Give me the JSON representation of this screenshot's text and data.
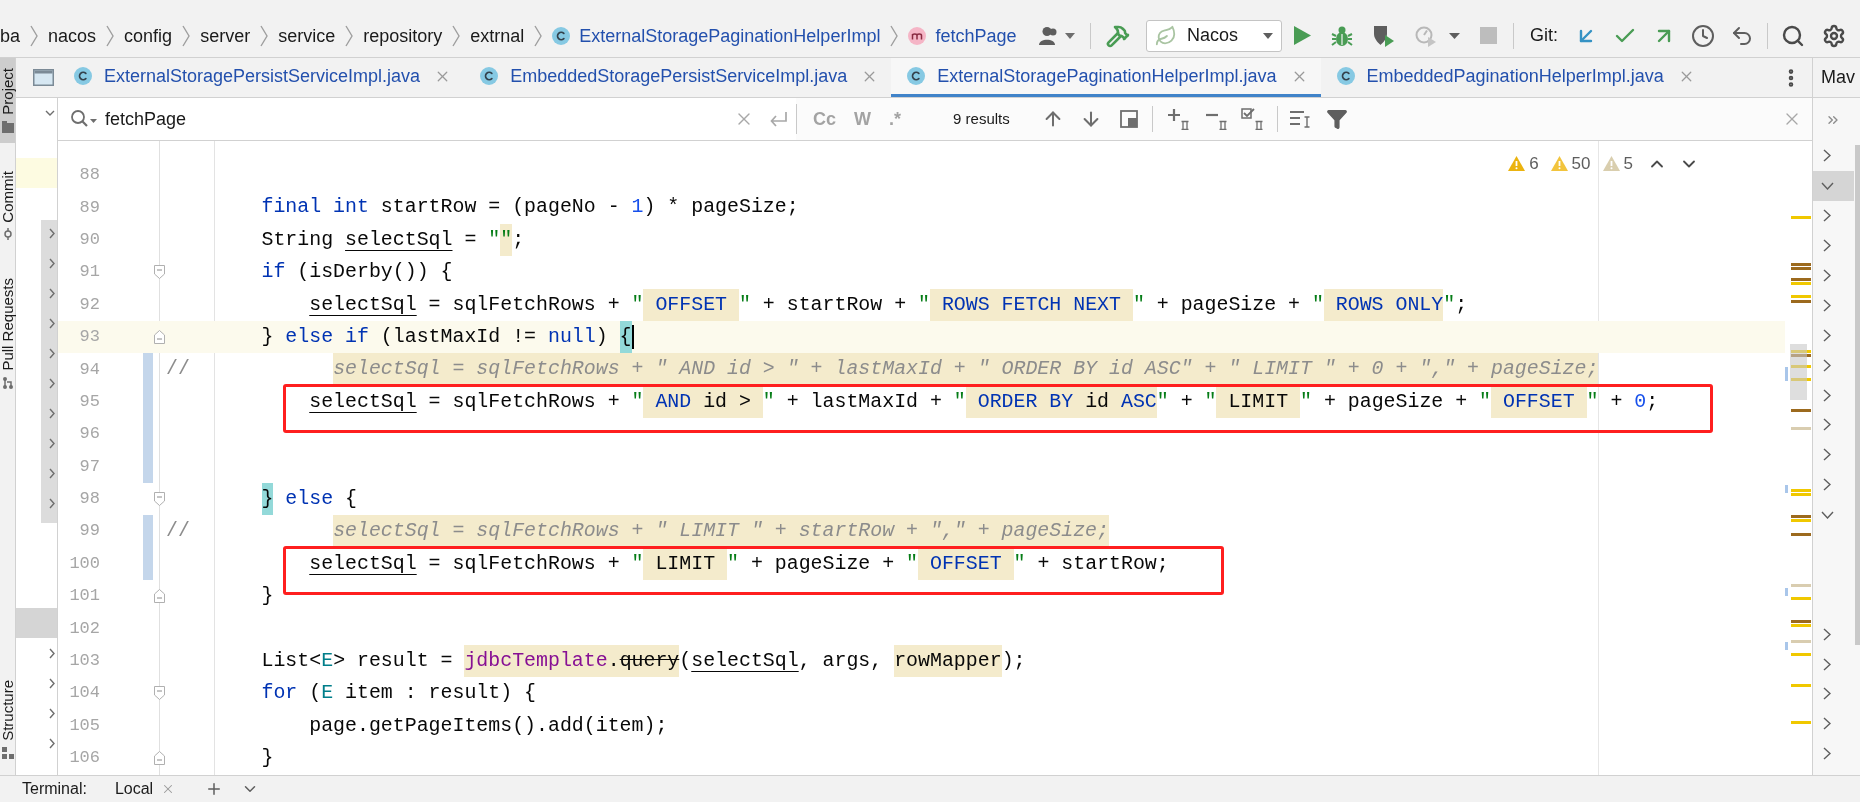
{
  "breadcrumbs": [
    {
      "label": "ba",
      "kind": "package"
    },
    {
      "label": "nacos",
      "kind": "package"
    },
    {
      "label": "config",
      "kind": "package"
    },
    {
      "label": "server",
      "kind": "package"
    },
    {
      "label": "service",
      "kind": "package"
    },
    {
      "label": "repository",
      "kind": "package"
    },
    {
      "label": "extrnal",
      "kind": "package"
    },
    {
      "label": "ExternalStoragePaginationHelperImpl",
      "kind": "class"
    },
    {
      "label": "fetchPage",
      "kind": "method"
    }
  ],
  "toolbar": {
    "run_config": {
      "label": "Nacos"
    },
    "run_actions": [
      {
        "kind": "run",
        "disabled": false
      },
      {
        "kind": "debug",
        "disabled": false
      },
      {
        "kind": "coverage",
        "disabled": false
      },
      {
        "kind": "profile",
        "disabled": true
      },
      {
        "kind": "more",
        "disabled": false
      },
      {
        "kind": "stop",
        "disabled": true
      }
    ],
    "vcs_label": "Git:",
    "vcs_actions": [
      {
        "kind": "update"
      },
      {
        "kind": "commit"
      },
      {
        "kind": "push"
      },
      {
        "kind": "history"
      },
      {
        "kind": "rollback"
      }
    ]
  },
  "tool_windows": {
    "top": [
      {
        "label": "Project",
        "kind": "project",
        "selected": true
      },
      {
        "label": "Commit",
        "kind": "commit",
        "selected": false
      },
      {
        "label": "Pull Requests",
        "kind": "pull-requests",
        "selected": false
      }
    ],
    "bottom": [
      {
        "label": "Structure",
        "kind": "structure",
        "selected": false
      }
    ]
  },
  "tabs": [
    {
      "label": "ExternalStoragePersistServiceImpl.java",
      "selected": false
    },
    {
      "label": "EmbeddedStoragePersistServiceImpl.java",
      "selected": false
    },
    {
      "label": "ExternalStoragePaginationHelperImpl.java",
      "selected": true
    },
    {
      "label": "EmbeddedPaginationHelperImpl.java",
      "selected": false
    }
  ],
  "project_panel": {
    "rows": [
      {
        "kind": "node",
        "expanded": true,
        "selected": false,
        "highlighted": false
      },
      {
        "kind": "leaf",
        "selected": false,
        "highlighted": false
      },
      {
        "kind": "leaf",
        "selected": false,
        "highlighted": true
      },
      {
        "kind": "leaf",
        "selected": false,
        "highlighted": false
      },
      {
        "kind": "node",
        "expanded": false,
        "selected": false,
        "highlighted": false
      },
      {
        "kind": "node",
        "expanded": false,
        "selected": false,
        "highlighted": false
      },
      {
        "kind": "node",
        "expanded": false,
        "selected": false,
        "highlighted": false
      },
      {
        "kind": "node",
        "expanded": false,
        "selected": false,
        "highlighted": false
      },
      {
        "kind": "node",
        "expanded": false,
        "selected": false,
        "highlighted": false
      },
      {
        "kind": "node",
        "expanded": false,
        "selected": false,
        "highlighted": false
      },
      {
        "kind": "node",
        "expanded": false,
        "selected": false,
        "highlighted": false
      },
      {
        "kind": "node",
        "expanded": false,
        "selected": false,
        "highlighted": false
      },
      {
        "kind": "node",
        "expanded": false,
        "selected": false,
        "highlighted": false
      },
      {
        "kind": "node",
        "expanded": false,
        "selected": false,
        "highlighted": false
      },
      {
        "kind": "leaf",
        "selected": false,
        "highlighted": false
      },
      {
        "kind": "leaf",
        "selected": false,
        "highlighted": false
      },
      {
        "kind": "leaf",
        "selected": false,
        "highlighted": false
      },
      {
        "kind": "leaf",
        "selected": true,
        "highlighted": false
      },
      {
        "kind": "node",
        "expanded": false,
        "selected": false,
        "highlighted": false
      },
      {
        "kind": "node",
        "expanded": false,
        "selected": false,
        "highlighted": false
      },
      {
        "kind": "node",
        "expanded": false,
        "selected": false,
        "highlighted": false
      },
      {
        "kind": "node",
        "expanded": false,
        "selected": false,
        "highlighted": false
      }
    ]
  },
  "find": {
    "value": "fetchPage",
    "options": [
      {
        "label": "Cc",
        "selected": false
      },
      {
        "label": "W",
        "selected": false
      },
      {
        "label": ".*",
        "selected": false
      }
    ],
    "results": "9 results"
  },
  "inspections": [
    {
      "count": "6",
      "color": "#ebb30f"
    },
    {
      "count": "50",
      "color": "#f2c43d"
    },
    {
      "count": "5",
      "color": "#d9ceae"
    }
  ],
  "editor": {
    "lines": [
      {
        "number": "88",
        "current": false,
        "changed": false,
        "boxed": false
      },
      {
        "number": "89",
        "current": false,
        "changed": false,
        "boxed": false,
        "tokens": [
          {
            "text": "        final int",
            "kind": "keyword"
          },
          {
            "text": " startRow = (pageNo - ",
            "kind": "plain"
          },
          {
            "text": "1",
            "kind": "number"
          },
          {
            "text": ") * pageSize;",
            "kind": "plain"
          }
        ]
      },
      {
        "number": "90",
        "current": false,
        "changed": false,
        "boxed": false,
        "tokens": [
          {
            "text": "        String ",
            "kind": "plain"
          },
          {
            "text": "selectSql",
            "kind": "variable"
          },
          {
            "text": " = ",
            "kind": "plain"
          },
          {
            "text": "\"",
            "kind": "quote"
          },
          {
            "text": "\"",
            "kind": "quote-marked"
          },
          {
            "text": ";",
            "kind": "plain"
          }
        ]
      },
      {
        "number": "91",
        "current": false,
        "changed": false,
        "boxed": false,
        "fold": {
          "kind": "start"
        },
        "tokens": [
          {
            "text": "        if",
            "kind": "keyword"
          },
          {
            "text": " (isDerby()) {",
            "kind": "plain"
          }
        ]
      },
      {
        "number": "92",
        "current": false,
        "changed": false,
        "boxed": false,
        "tokens": [
          {
            "text": "            selectSql",
            "kind": "variable"
          },
          {
            "text": " = sqlFetchRows + ",
            "kind": "plain"
          },
          {
            "text": "\"",
            "kind": "quote"
          },
          {
            "text": " OFFSET ",
            "kind": "sql-keyword"
          },
          {
            "text": "\"",
            "kind": "quote"
          },
          {
            "text": " + startRow + ",
            "kind": "plain"
          },
          {
            "text": "\"",
            "kind": "quote"
          },
          {
            "text": " ROWS FETCH NEXT ",
            "kind": "sql-keyword"
          },
          {
            "text": "\"",
            "kind": "quote"
          },
          {
            "text": " + pageSize + ",
            "kind": "plain"
          },
          {
            "text": "\"",
            "kind": "quote"
          },
          {
            "text": " ROWS ONLY",
            "kind": "sql-keyword"
          },
          {
            "text": "\"",
            "kind": "quote"
          },
          {
            "text": ";",
            "kind": "plain"
          }
        ]
      },
      {
        "number": "93",
        "current": true,
        "changed": false,
        "boxed": false,
        "fold": {
          "kind": "end"
        },
        "tokens": [
          {
            "text": "        }",
            "kind": "plain"
          },
          {
            "text": " else if",
            "kind": "keyword"
          },
          {
            "text": " (lastMaxId != ",
            "kind": "plain"
          },
          {
            "text": "null",
            "kind": "keyword"
          },
          {
            "text": ") ",
            "kind": "plain"
          },
          {
            "text": "{",
            "kind": "brace-match"
          }
        ]
      },
      {
        "number": "94",
        "current": false,
        "changed": true,
        "boxed": false,
        "tokens": [
          {
            "text": "//",
            "kind": "comment"
          },
          {
            "text": "            selectSql = sqlFetchRows + \" AND id > \" + lastMaxId + \" ORDER BY id ASC\" + \" LIMIT \" + 0 + \",\" + pageSize;",
            "kind": "comment-marked"
          }
        ]
      },
      {
        "number": "95",
        "current": false,
        "changed": true,
        "boxed": true,
        "tokens": [
          {
            "text": "            selectSql",
            "kind": "variable"
          },
          {
            "text": " = sqlFetchRows + ",
            "kind": "plain"
          },
          {
            "text": "\"",
            "kind": "quote"
          },
          {
            "text": " AND ",
            "kind": "sql-keyword"
          },
          {
            "text": "id > ",
            "kind": "sql"
          },
          {
            "text": "\"",
            "kind": "quote"
          },
          {
            "text": " + lastMaxId + ",
            "kind": "plain"
          },
          {
            "text": "\"",
            "kind": "quote"
          },
          {
            "text": " ORDER BY ",
            "kind": "sql-keyword"
          },
          {
            "text": "id",
            "kind": "sql"
          },
          {
            "text": " ASC",
            "kind": "sql-keyword"
          },
          {
            "text": "\"",
            "kind": "quote"
          },
          {
            "text": " + ",
            "kind": "plain"
          },
          {
            "text": "\"",
            "kind": "quote"
          },
          {
            "text": " LIMIT ",
            "kind": "sql"
          },
          {
            "text": "\"",
            "kind": "quote"
          },
          {
            "text": " + pageSize + ",
            "kind": "plain"
          },
          {
            "text": "\"",
            "kind": "quote"
          },
          {
            "text": " OFFSET ",
            "kind": "sql-keyword"
          },
          {
            "text": "\"",
            "kind": "quote"
          },
          {
            "text": " + ",
            "kind": "plain"
          },
          {
            "text": "0",
            "kind": "number"
          },
          {
            "text": ";",
            "kind": "plain"
          }
        ]
      },
      {
        "number": "96",
        "current": false,
        "changed": true,
        "boxed": false
      },
      {
        "number": "97",
        "current": false,
        "changed": true,
        "boxed": false
      },
      {
        "number": "98",
        "current": false,
        "changed": false,
        "boxed": false,
        "fold": {
          "kind": "start"
        },
        "tokens": [
          {
            "text": "        }",
            "kind": "brace-match"
          },
          {
            "text": " else",
            "kind": "keyword"
          },
          {
            "text": " {",
            "kind": "plain"
          }
        ]
      },
      {
        "number": "99",
        "current": false,
        "changed": true,
        "boxed": false,
        "tokens": [
          {
            "text": "//",
            "kind": "comment"
          },
          {
            "text": "            selectSql = sqlFetchRows + \" LIMIT \" + startRow + \",\" + pageSize;",
            "kind": "comment-marked"
          }
        ]
      },
      {
        "number": "100",
        "current": false,
        "changed": true,
        "boxed": true,
        "tokens": [
          {
            "text": "            selectSql",
            "kind": "variable"
          },
          {
            "text": " = sqlFetchRows + ",
            "kind": "plain"
          },
          {
            "text": "\"",
            "kind": "quote"
          },
          {
            "text": " LIMIT ",
            "kind": "sql"
          },
          {
            "text": "\"",
            "kind": "quote"
          },
          {
            "text": " + pageSize + ",
            "kind": "plain"
          },
          {
            "text": "\"",
            "kind": "quote"
          },
          {
            "text": " OFFSET ",
            "kind": "sql-keyword"
          },
          {
            "text": "\"",
            "kind": "quote"
          },
          {
            "text": " + startRow;",
            "kind": "plain"
          }
        ]
      },
      {
        "number": "101",
        "current": false,
        "changed": false,
        "boxed": false,
        "fold": {
          "kind": "end"
        },
        "tokens": [
          {
            "text": "        }",
            "kind": "plain"
          }
        ]
      },
      {
        "number": "102",
        "current": false,
        "changed": false,
        "boxed": false
      },
      {
        "number": "103",
        "current": false,
        "changed": false,
        "boxed": false,
        "tokens": [
          {
            "text": "        List<",
            "kind": "plain"
          },
          {
            "text": "E",
            "kind": "type-param"
          },
          {
            "text": "> result = ",
            "kind": "plain"
          },
          {
            "text": "jdbcTemplate",
            "kind": "field-marked"
          },
          {
            "text": ".",
            "kind": "marked"
          },
          {
            "text": "query",
            "kind": "deprecated-marked"
          },
          {
            "text": "(",
            "kind": "plain"
          },
          {
            "text": "selectSql",
            "kind": "variable"
          },
          {
            "text": ", args, ",
            "kind": "plain"
          },
          {
            "text": "rowMapper",
            "kind": "marked"
          },
          {
            "text": ");",
            "kind": "plain"
          }
        ]
      },
      {
        "number": "104",
        "current": false,
        "changed": false,
        "boxed": false,
        "fold": {
          "kind": "start"
        },
        "tokens": [
          {
            "text": "        for",
            "kind": "keyword"
          },
          {
            "text": " (",
            "kind": "plain"
          },
          {
            "text": "E",
            "kind": "type-param"
          },
          {
            "text": " item : result) {",
            "kind": "plain"
          }
        ]
      },
      {
        "number": "105",
        "current": false,
        "changed": false,
        "boxed": false,
        "tokens": [
          {
            "text": "            page.getPageItems().add(item);",
            "kind": "plain"
          }
        ]
      },
      {
        "number": "106",
        "current": false,
        "changed": false,
        "boxed": false,
        "fold": {
          "kind": "end"
        },
        "tokens": [
          {
            "text": "        }",
            "kind": "plain"
          }
        ]
      }
    ]
  },
  "maven_panel": {
    "title": "Mav",
    "rows": [
      {
        "kind": "node",
        "expanded": false,
        "selected": false
      },
      {
        "kind": "node",
        "expanded": true,
        "selected": true
      },
      {
        "kind": "node",
        "expanded": false,
        "selected": false
      },
      {
        "kind": "node",
        "expanded": false,
        "selected": false
      },
      {
        "kind": "node",
        "expanded": false,
        "selected": false
      },
      {
        "kind": "node",
        "expanded": false,
        "selected": false
      },
      {
        "kind": "node",
        "expanded": false,
        "selected": false
      },
      {
        "kind": "node",
        "expanded": false,
        "selected": false
      },
      {
        "kind": "node",
        "expanded": false,
        "selected": false
      },
      {
        "kind": "node",
        "expanded": false,
        "selected": false
      },
      {
        "kind": "node",
        "expanded": false,
        "selected": false
      },
      {
        "kind": "node",
        "expanded": false,
        "selected": false
      },
      {
        "kind": "node",
        "expanded": true,
        "selected": false
      },
      {
        "kind": "leaf",
        "selected": false
      },
      {
        "kind": "leaf",
        "selected": false
      },
      {
        "kind": "leaf",
        "selected": false
      },
      {
        "kind": "node",
        "expanded": false,
        "selected": false
      },
      {
        "kind": "node",
        "expanded": false,
        "selected": false
      },
      {
        "kind": "node",
        "expanded": false,
        "selected": false
      },
      {
        "kind": "node",
        "expanded": false,
        "selected": false
      },
      {
        "kind": "node",
        "expanded": false,
        "selected": false
      }
    ]
  },
  "bottom_bar": {
    "title": "Terminal:",
    "tabs": [
      {
        "label": "Local"
      }
    ]
  }
}
